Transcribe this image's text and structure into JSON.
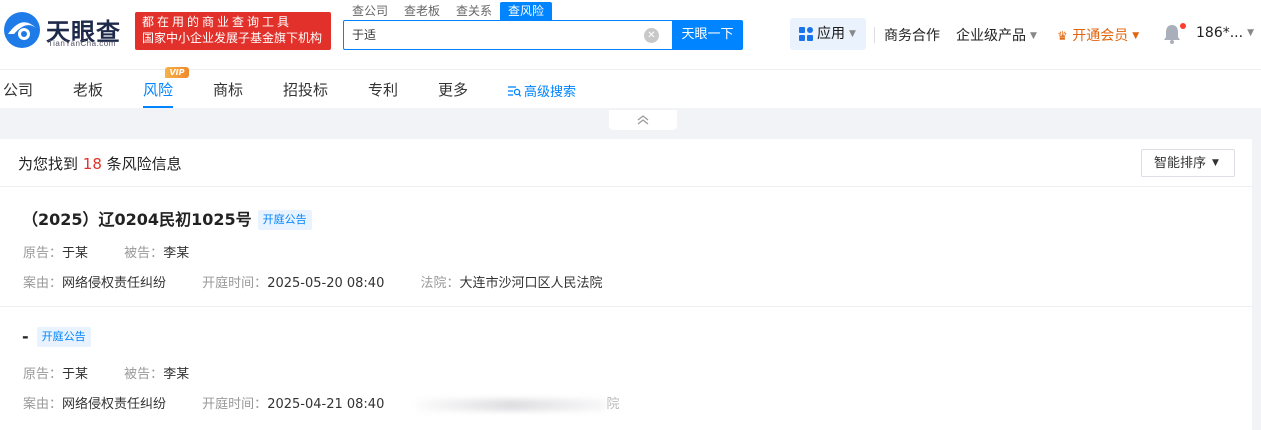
{
  "brand": {
    "name": "天眼查",
    "domain": "TianYanCha.com",
    "slogan_line1": "都在用的商业查询工具",
    "slogan_line2": "国家中小企业发展子基金旗下机构"
  },
  "search": {
    "tabs": [
      "查公司",
      "查老板",
      "查关系",
      "查风险"
    ],
    "active_tab": "查风险",
    "value": "于适",
    "button_label": "天眼一下"
  },
  "top_nav": {
    "apps_label": "应用",
    "business": "商务合作",
    "enterprise": "企业级产品",
    "vip": "开通会员",
    "user": "186*..."
  },
  "sub_nav": {
    "items": [
      "公司",
      "老板",
      "风险",
      "商标",
      "招投标",
      "专利",
      "更多"
    ],
    "active": "风险",
    "vip_badge": "VIP",
    "advanced_search": "高级搜索"
  },
  "results": {
    "prefix": "为您找到",
    "count": "18",
    "suffix": "条风险信息",
    "sort_label": "智能排序",
    "items": [
      {
        "title": "（2025）辽0204民初1025号",
        "tag": "开庭公告",
        "plaintiff_label": "原告：",
        "plaintiff": "于某",
        "defendant_label": "被告：",
        "defendant": "李某",
        "cause_label": "案由：",
        "cause": "网络侵权责任纠纷",
        "time_label": "开庭时间：",
        "time": "2025-05-20 08:40",
        "court_label": "法院：",
        "court": "大连市沙河口区人民法院"
      },
      {
        "title": "-",
        "tag": "开庭公告",
        "plaintiff_label": "原告：",
        "plaintiff": "于某",
        "defendant_label": "被告：",
        "defendant": "李某",
        "cause_label": "案由：",
        "cause": "网络侵权责任纠纷",
        "time_label": "开庭时间：",
        "time": "2025-04-21 08:40",
        "court_tail": "院"
      }
    ]
  },
  "colors": {
    "accent": "#0084ff",
    "slogan_bg": "#e2312a",
    "vip": "#e0650e",
    "count": "#e2312a"
  }
}
